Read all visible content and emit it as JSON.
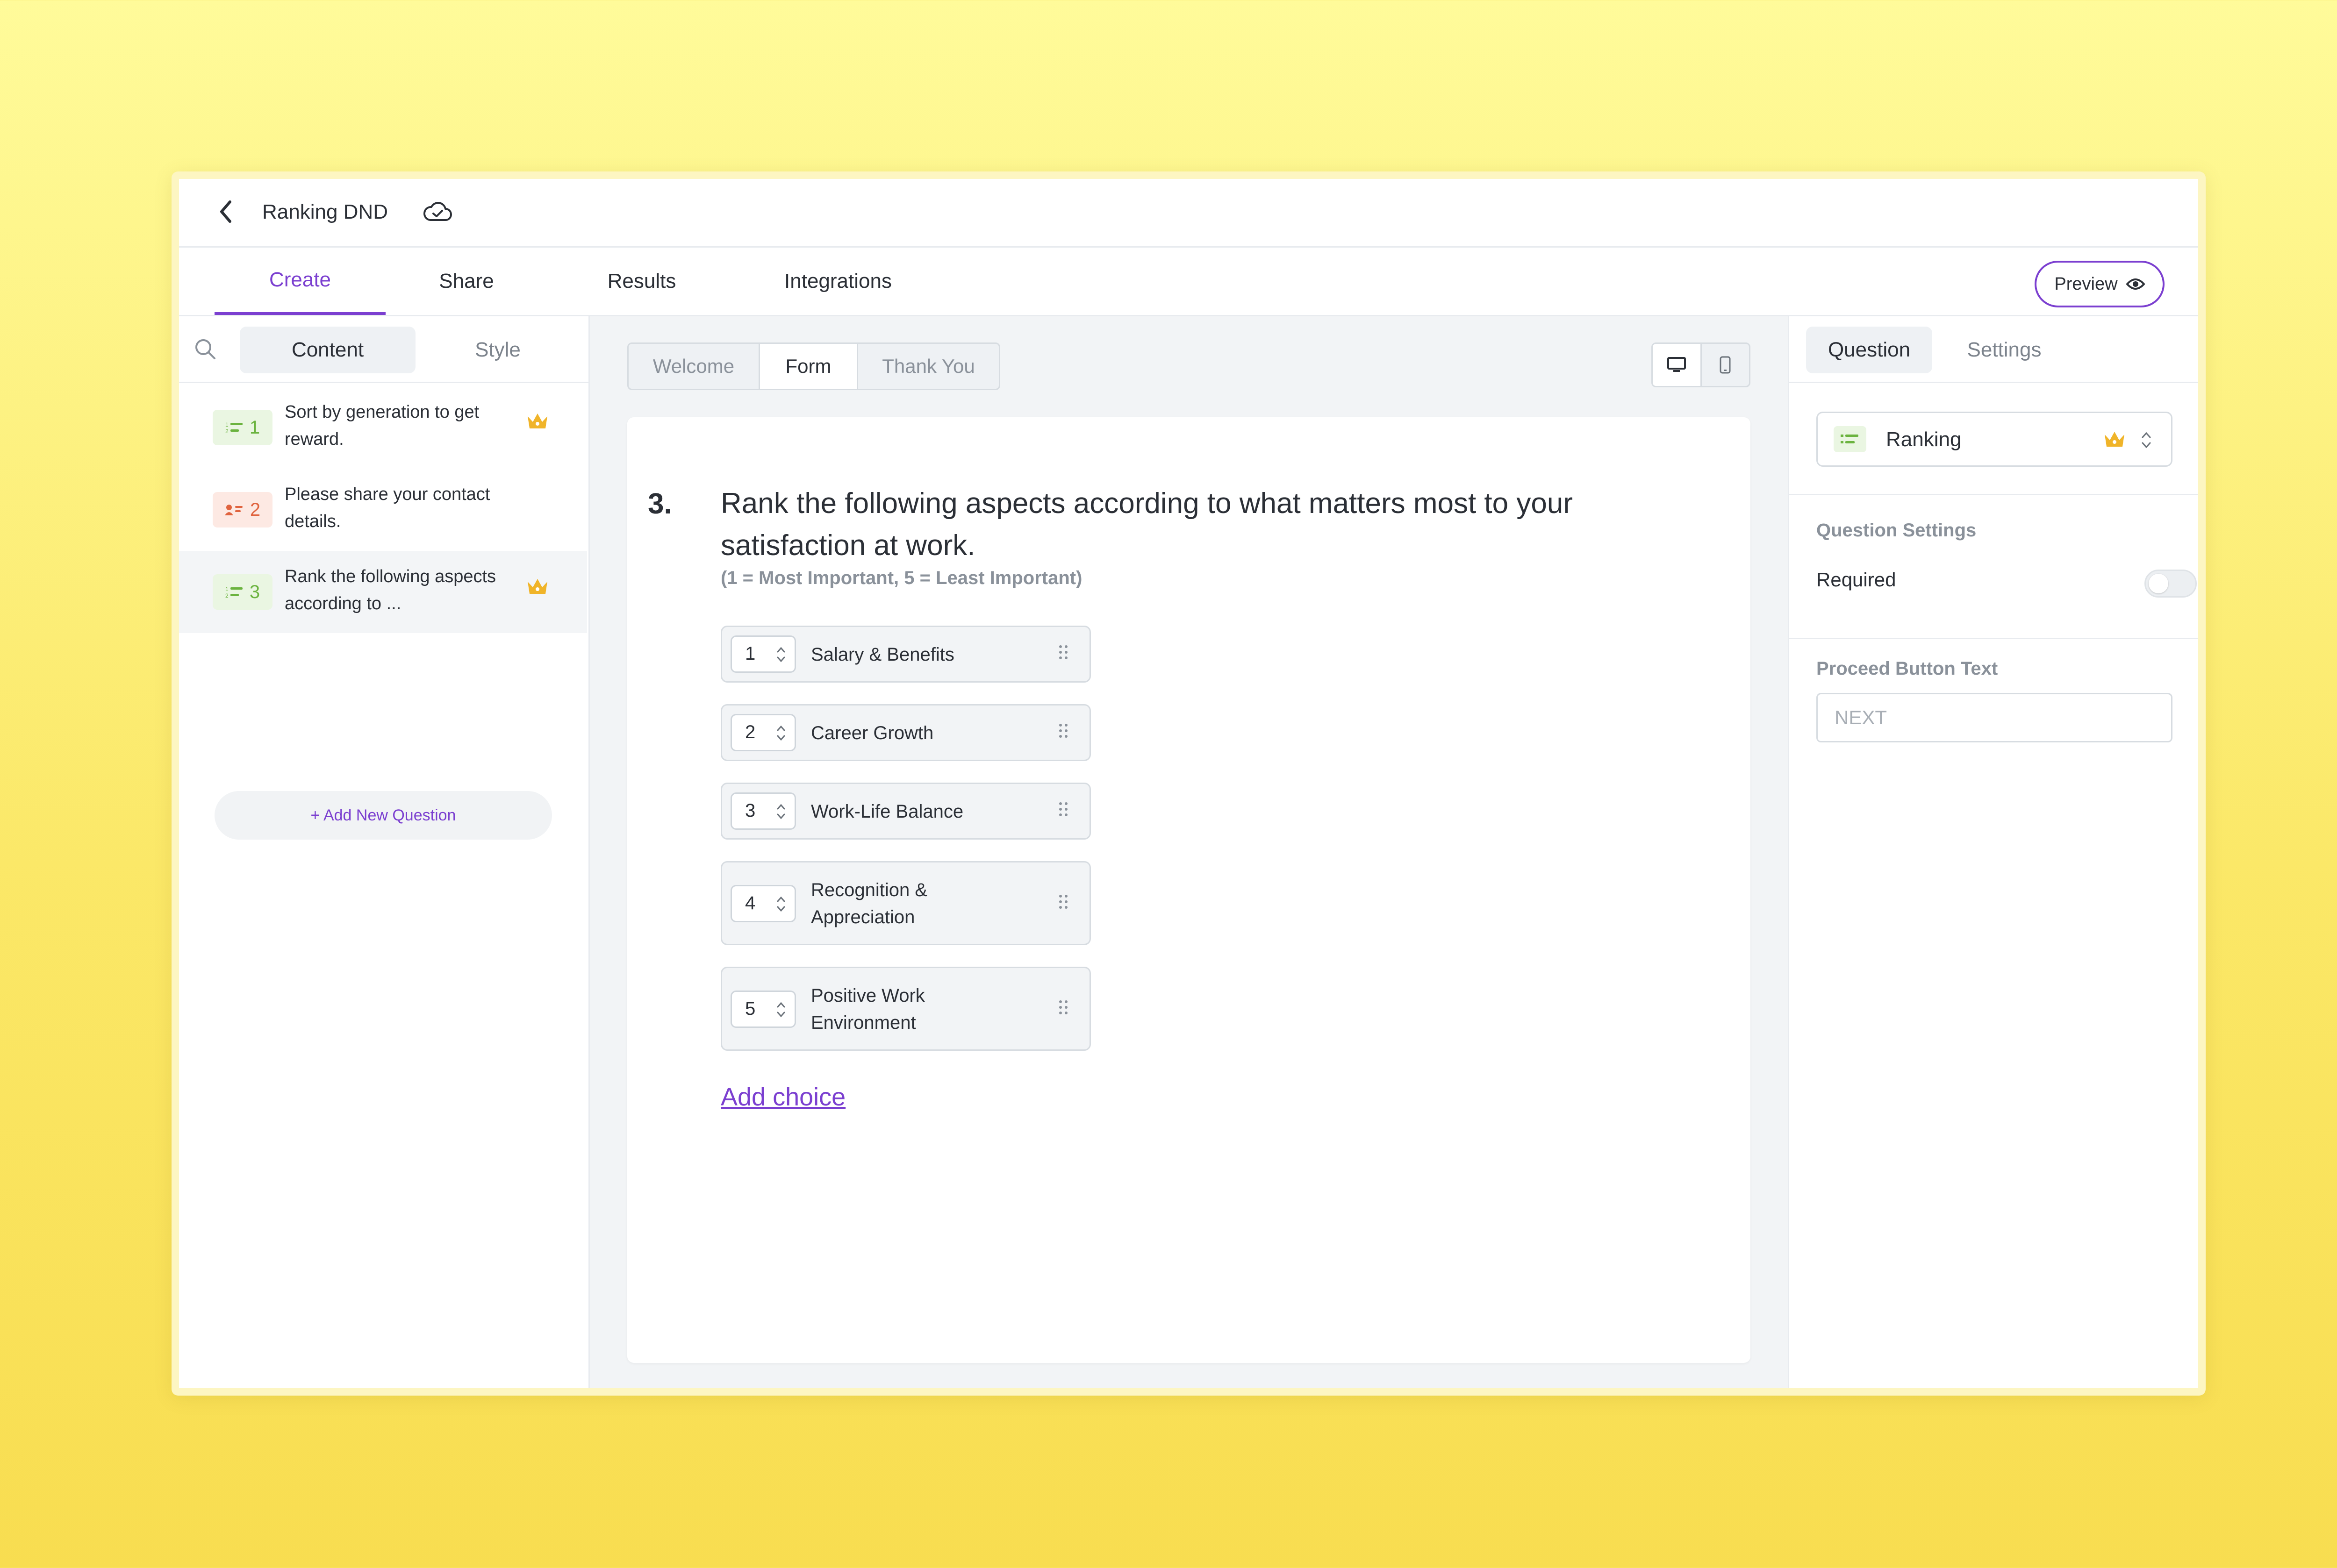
{
  "header": {
    "title": "Ranking DND"
  },
  "main_tabs": [
    {
      "label": "Create"
    },
    {
      "label": "Share"
    },
    {
      "label": "Results"
    },
    {
      "label": "Integrations"
    }
  ],
  "preview_label": "Preview",
  "left_panel": {
    "segments": [
      "Content",
      "Style"
    ],
    "questions": [
      {
        "number": "1",
        "text": "Sort by generation to get reward.",
        "type_icon": "ranking-icon",
        "premium": true
      },
      {
        "number": "2",
        "text": "Please share your contact details.",
        "type_icon": "contact-icon",
        "premium": false
      },
      {
        "number": "3",
        "text": "Rank the following aspects according to ...",
        "type_icon": "ranking-icon",
        "premium": true
      }
    ],
    "add_question_label": "+ Add New Question"
  },
  "center": {
    "page_tabs": [
      "Welcome",
      "Form",
      "Thank You"
    ],
    "question": {
      "number": "3.",
      "title": "Rank the following aspects according to what matters most to your satisfaction at work.",
      "subtitle": "(1 = Most Important, 5 = Least Important)",
      "choices": [
        {
          "rank": "1",
          "label": "Salary & Benefits"
        },
        {
          "rank": "2",
          "label": "Career Growth"
        },
        {
          "rank": "3",
          "label": "Work-Life Balance"
        },
        {
          "rank": "4",
          "label": "Recognition & Appreciation"
        },
        {
          "rank": "5",
          "label": "Positive Work Environment"
        }
      ],
      "add_choice_label": "Add choice"
    }
  },
  "right_panel": {
    "tabs": [
      "Question",
      "Settings"
    ],
    "question_type": "Ranking",
    "question_settings_label": "Question Settings",
    "required_label": "Required",
    "required_on": false,
    "proceed_label": "Proceed Button Text",
    "proceed_placeholder": "NEXT"
  },
  "colors": {
    "accent": "#7b3fd0",
    "premium": "#f0b429",
    "ranking_badge": "#6bb33f",
    "contact_badge": "#e0633e"
  }
}
